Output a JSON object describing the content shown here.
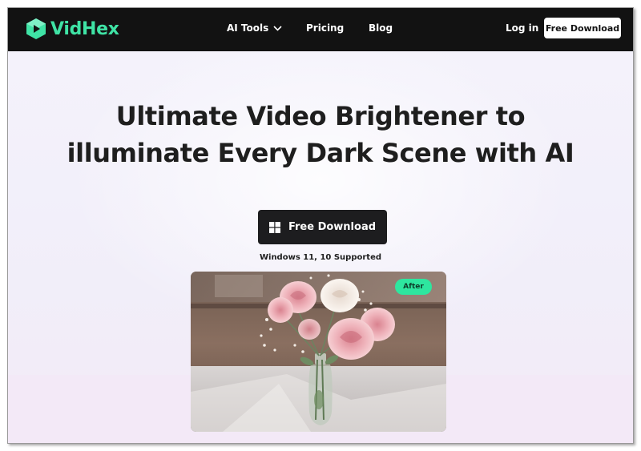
{
  "brand": {
    "name": "VidHex",
    "accent_color": "#3fe3a5"
  },
  "nav": {
    "ai_tools_label": "AI Tools",
    "ai_tools_icon": "chevron-down-icon",
    "pricing_label": "Pricing",
    "blog_label": "Blog",
    "login_label": "Log in",
    "free_download_label": "Free Download"
  },
  "hero": {
    "headline_line1": "Ultimate Video Brightener to",
    "headline_line2": "illuminate Every Dark Scene with AI",
    "cta_label": "Free Download",
    "cta_icon": "windows-icon",
    "support_note": "Windows 11, 10 Supported",
    "preview_badge": "After",
    "badge_color": "#2ee69f"
  }
}
